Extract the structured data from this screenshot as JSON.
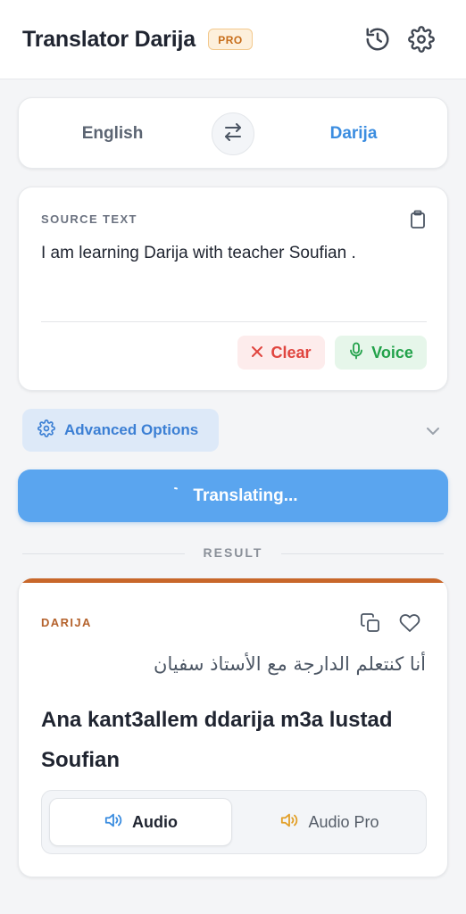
{
  "header": {
    "title": "Translator Darija",
    "badge": "PRO",
    "history_icon": "history-icon",
    "settings_icon": "gear-icon"
  },
  "languages": {
    "source": "English",
    "target": "Darija",
    "swap_icon": "swap-arrows-icon"
  },
  "source": {
    "label": "SOURCE TEXT",
    "text": "I am learning Darija with teacher Soufian .",
    "clear_label": "Clear",
    "voice_label": "Voice"
  },
  "advanced": {
    "label": "Advanced Options"
  },
  "translate": {
    "label": "Translating..."
  },
  "result": {
    "section_label": "RESULT",
    "language_label": "DARIJA",
    "arabic_text": "أنا كنتعلم الدارجة مع الأستاذ سفيان",
    "latin_text": "Ana kant3allem ddarija m3a lustad Soufian",
    "audio_label": "Audio",
    "audio_pro_label": "Audio Pro"
  },
  "colors": {
    "accent_blue": "#3b8de0",
    "translate_button": "#5aa5ef",
    "clear_red": "#e0453f",
    "voice_green": "#22a24a",
    "darija_orange": "#c8672a",
    "pro_badge": "#c76d19"
  }
}
